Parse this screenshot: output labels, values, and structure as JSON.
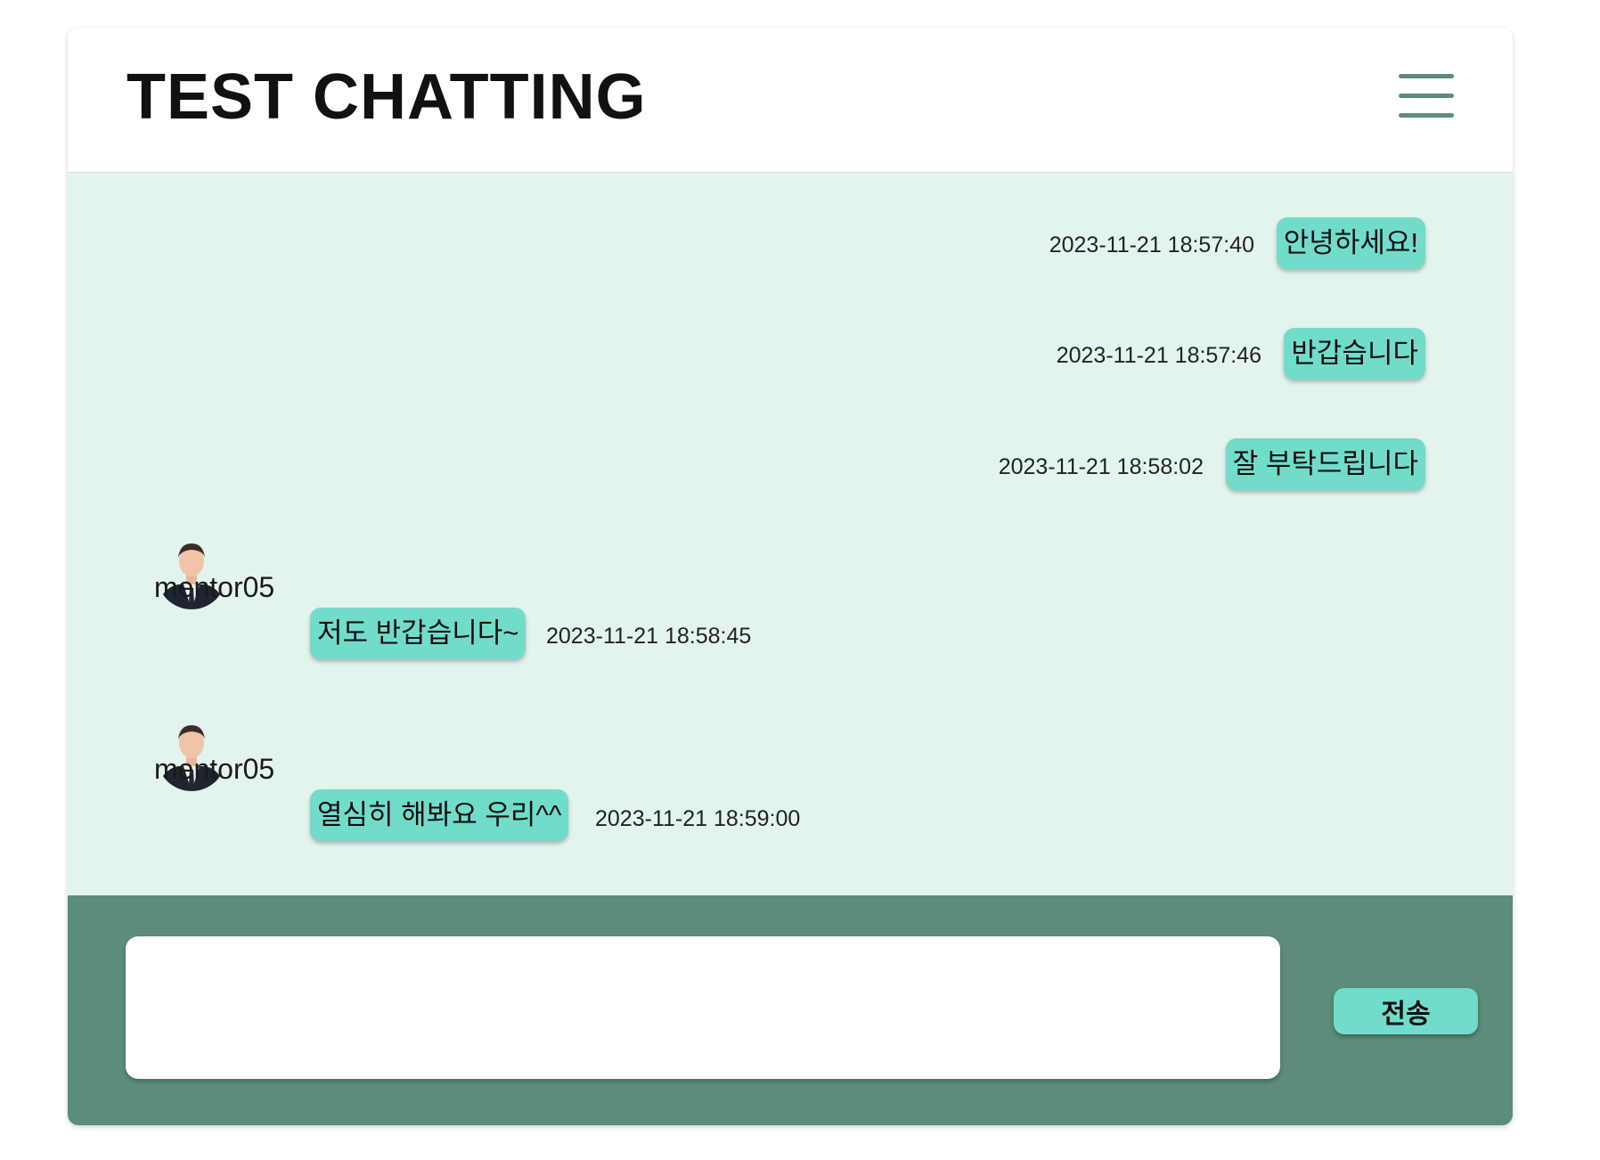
{
  "theme": {
    "accent_dark": "#5b8d7a",
    "bubble": "#72dccb",
    "chat_bg": "#e3f4ee"
  },
  "header": {
    "title": "TEST CHATTING",
    "menu_icon": "hamburger-menu-icon"
  },
  "messages": [
    {
      "side": "mine",
      "text": "안녕하세요!",
      "timestamp": "2023-11-21 18:57:40"
    },
    {
      "side": "mine",
      "text": "반갑습니다",
      "timestamp": "2023-11-21 18:57:46"
    },
    {
      "side": "mine",
      "text": "잘 부탁드립니다",
      "timestamp": "2023-11-21 18:58:02"
    },
    {
      "side": "other",
      "sender": "mentor05",
      "avatar_icon": "user-avatar",
      "text": "저도 반갑습니다~",
      "timestamp": "2023-11-21 18:58:45"
    },
    {
      "side": "other",
      "sender": "mentor05",
      "avatar_icon": "user-avatar",
      "text": "열심히 해봐요 우리^^",
      "timestamp": "2023-11-21 18:59:00"
    }
  ],
  "composer": {
    "input_value": "",
    "send_label": "전송"
  }
}
